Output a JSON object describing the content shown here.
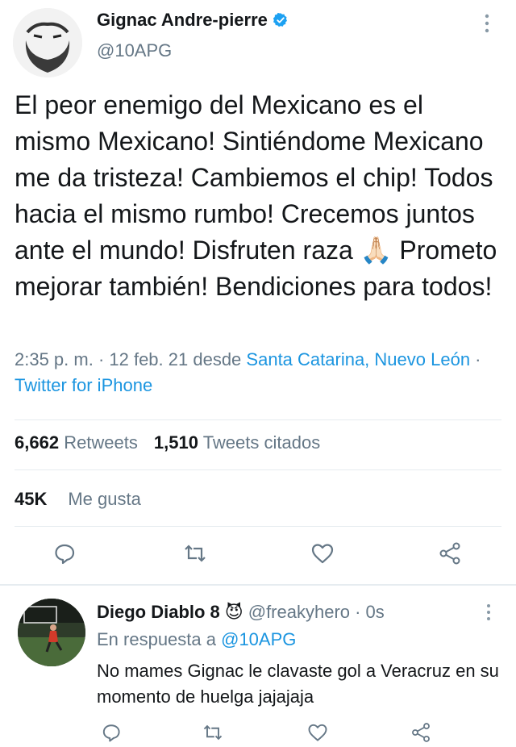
{
  "tweet": {
    "author_name": "Gignac Andre-pierre",
    "author_handle": "@10APG",
    "text": "El peor enemigo del Mexicano es el mismo Mexicano! Sintiéndome Mexicano me da tristeza! Cambiemos el chip! Todos hacia el mismo rumbo! Crecemos juntos ante el mundo! Disfruten raza 🙏🏻 Prometo mejorar también! Bendiciones para todos!",
    "time": "2:35 p. m. · 12 feb. 21 desde ",
    "location": "Santa Catarina, Nuevo León",
    "separator": " · ",
    "source": "Twitter for iPhone",
    "retweets_count": "6,662",
    "retweets_label": "Retweets",
    "quotes_count": "1,510",
    "quotes_label": "Tweets citados",
    "likes_count": "45K",
    "likes_label": "Me gusta"
  },
  "reply": {
    "author_name": "Diego Diablo 8",
    "emoji": "😈",
    "handle_time": "@freakyhero · 0s",
    "reply_to_label": "En respuesta a ",
    "reply_to_handle": "@10APG",
    "text": "No mames Gignac le clavaste gol a Veracruz en su momento de huelga jajajaja"
  },
  "icons": {
    "reply": "reply-icon",
    "retweet": "retweet-icon",
    "like": "like-icon",
    "share": "share-icon",
    "more": "more-vertical-icon",
    "verified": "verified-badge-icon"
  },
  "colors": {
    "link": "#1b95e0",
    "secondary": "#657786",
    "primary_text": "#14171a",
    "icon": "#657786"
  }
}
